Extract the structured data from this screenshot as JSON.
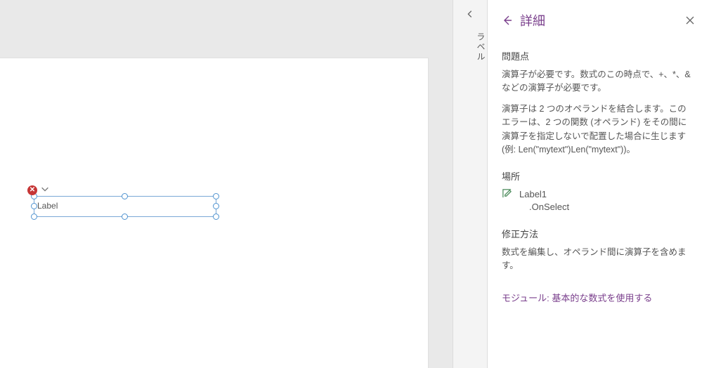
{
  "canvas": {
    "control_label": "Label"
  },
  "tab": {
    "label": "ラベル"
  },
  "details": {
    "title": "詳細",
    "sections": {
      "issue_heading": "問題点",
      "issue_p1": "演算子が必要です。数式のこの時点で、+、*、& などの演算子が必要です。",
      "issue_p2": "演算子は 2 つのオペランドを結合します。このエラーは、2 つの関数 (オペランド) をその間に演算子を指定しないで配置した場合に生じます (例: Len(\"mytext\")Len(\"mytext\"))。",
      "location_heading": "場所",
      "location_control": "Label1",
      "location_property": ".OnSelect",
      "fix_heading": "修正方法",
      "fix_body": "数式を編集し、オペランド間に演算子を含めます。",
      "module_link": "モジュール: 基本的な数式を使用する"
    }
  }
}
